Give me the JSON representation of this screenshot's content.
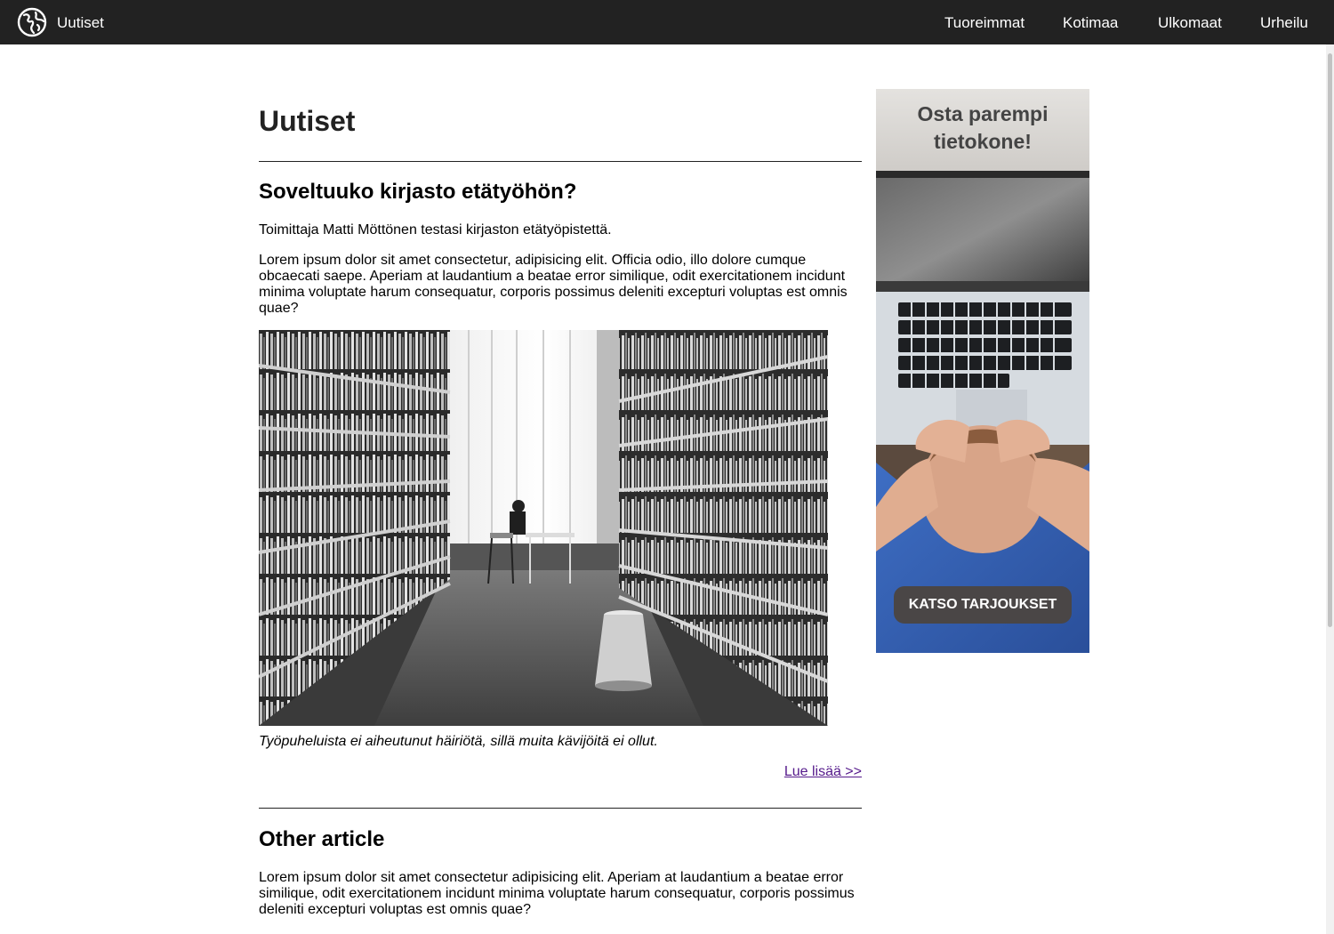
{
  "header": {
    "brand": "Uutiset",
    "nav": [
      "Tuoreimmat",
      "Kotimaa",
      "Ulkomaat",
      "Urheilu"
    ]
  },
  "main": {
    "title": "Uutiset",
    "articles": [
      {
        "heading": "Soveltuuko kirjasto etätyöhön?",
        "byline": "Toimittaja Matti Möttönen testasi kirjaston etätyöpistettä.",
        "body": "Lorem ipsum dolor sit amet consectetur, adipisicing elit. Officia odio, illo dolore cumque obcaecati saepe. Aperiam at laudantium a beatae error similique, odit exercitationem incidunt minima voluptate harum consequatur, corporis possimus deleniti excepturi voluptas est omnis quae?",
        "caption": "Työpuheluista ei aiheutunut häiriötä, sillä muita kävijöitä ei ollut.",
        "read_more": "Lue lisää >>"
      },
      {
        "heading": "Other article",
        "body": "Lorem ipsum dolor sit amet consectetur adipisicing elit. Aperiam at laudantium a beatae error similique, odit exercitationem incidunt minima voluptate harum consequatur, corporis possimus deleniti excepturi voluptas est omnis quae?"
      }
    ]
  },
  "ad": {
    "headline_line1": "Osta parempi",
    "headline_line2": "tietokone!",
    "cta": "KATSO TARJOUKSET"
  },
  "colors": {
    "header_bg": "#222222",
    "link_visited": "#551a8b"
  },
  "icons": {
    "logo": "globe-icon"
  }
}
